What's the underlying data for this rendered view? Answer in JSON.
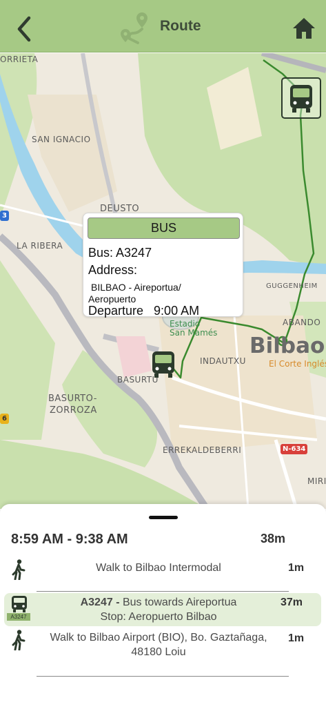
{
  "header": {
    "title": "Route",
    "accent_color": "#a6c985",
    "back_icon": "chevron-left-icon",
    "logo_icon": "route-pin-icon",
    "home_icon": "home-icon"
  },
  "map": {
    "labels": {
      "orrieta": "ORRIETA",
      "san_ignacio": "SAN IGNACIO",
      "deusto": "DEUSTO",
      "la_ribera": "LA RIBERA",
      "guggenheim": "GUGGENHEIM",
      "abando": "ABANDO",
      "bilbao": "Bilbao",
      "el_corte_ingles": "El Corte Inglés",
      "estadio": "Estadio",
      "san_mames": "San Mamés",
      "indautxu": "INDAUTXU",
      "basurtu": "BASURTU",
      "basurto": "BASURTO-",
      "zorroza": "ZORROZA",
      "errekaldeberri": "ERREKALDEBERRI",
      "miri": "MIRI",
      "n634": "N-634",
      "shield_3": "3",
      "shield_6": "6"
    },
    "route_color": "#3a8a2e"
  },
  "callout": {
    "header": "BUS",
    "bus_line": "Bus: A3247",
    "address_label": "Address:",
    "address_line1": "BILBAO - Aireportua/",
    "address_line2": "Aeropuerto",
    "departure": "Departure   9:00 AM"
  },
  "trip": {
    "time_range": "8:59 AM - 9:38 AM",
    "total_duration": "38m",
    "steps": [
      {
        "icon": "walking-icon",
        "text": "Walk to Bilbao Intermodal",
        "duration": "1m"
      },
      {
        "icon": "bus-icon",
        "badge": "A3247",
        "line_bold": "A3247 -",
        "line_rest": " Bus towards Aireportua",
        "stop": "Stop: Aeropuerto Bilbao",
        "duration": "37m"
      },
      {
        "icon": "walking-icon",
        "text_line1": "Walk to Bilbao Airport (BIO), Bo. Gaztañaga,",
        "text_line2": "48180 Loiu",
        "duration": "1m"
      }
    ]
  }
}
